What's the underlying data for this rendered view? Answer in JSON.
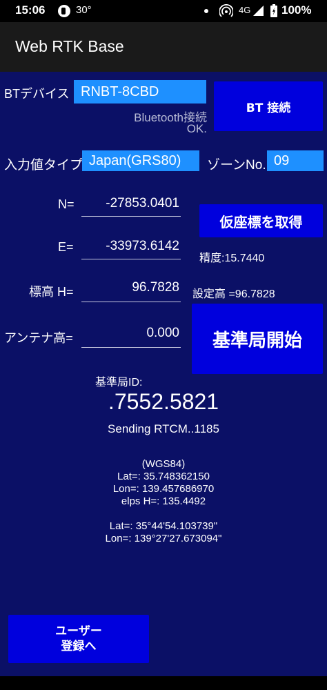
{
  "status_bar": {
    "time": "15:06",
    "app_icon": "app-notification-icon",
    "temperature": "30°",
    "network": "4G",
    "battery": "100%"
  },
  "app_bar": {
    "title": "Web RTK Base"
  },
  "bluetooth": {
    "label": "BTデバイス",
    "device": "RNBT-8CBD",
    "status_line1": "Bluetooth接続",
    "status_line2": "OK.",
    "connect_button": "BT 接続"
  },
  "input_type": {
    "label": "入力値タイプ",
    "value": "Japan(GRS80)",
    "zone_label": "ゾーンNo.",
    "zone_value": "09"
  },
  "coords": {
    "n_label": "N=",
    "n_value": "-27853.0401",
    "e_label": "E=",
    "e_value": "-33973.6142",
    "height_label": "標高 H=",
    "height_value": "96.7828",
    "antenna_label": "アンテナ高=",
    "antenna_value": "0.000"
  },
  "actions": {
    "get_coords_button": "仮座標を取得",
    "accuracy_text": "精度:15.7440",
    "set_height_text": "設定高 =96.7828",
    "start_base_button": "基準局開始"
  },
  "base_station": {
    "id_label": "基準局ID:",
    "id_value": ".7552.5821",
    "sending": "Sending RTCM..1185"
  },
  "wgs84": {
    "header": "(WGS84)",
    "lat": "Lat=: 35.748362150",
    "lon": "Lon=: 139.457686970",
    "elps": "elps H=: 135.4492",
    "lat_dms": "Lat=: 35°44'54.103739\"",
    "lon_dms": "Lon=: 139°27'27.673094\""
  },
  "user_button": {
    "line1": "ユーザー",
    "line2": "登録へ"
  },
  "colors": {
    "background": "#0b1066",
    "field": "#1e90ff",
    "button": "#0000dd"
  }
}
